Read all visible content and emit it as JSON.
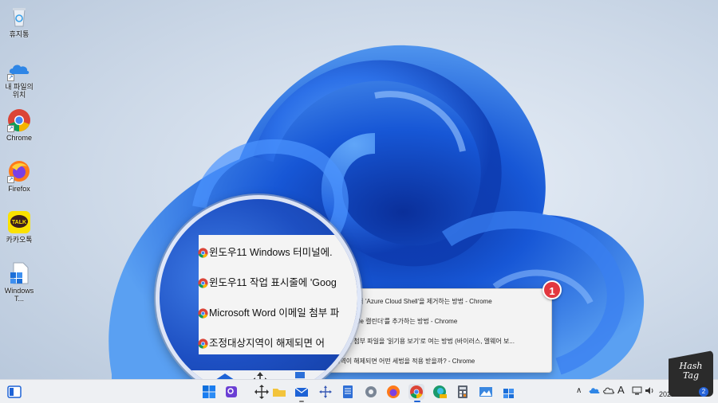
{
  "desktop_icons": [
    {
      "label": "휴지통",
      "icon": "recycle-bin-icon"
    },
    {
      "label": "내 파일의 위치",
      "icon": "onedrive-icon"
    },
    {
      "label": "Chrome",
      "icon": "chrome-icon"
    },
    {
      "label": "Firefox",
      "icon": "firefox-icon"
    },
    {
      "label": "카카오톡",
      "icon": "kakaotalk-icon"
    },
    {
      "label": "WindowsT...",
      "icon": "windows-terminal-file-icon"
    }
  ],
  "kakao_logo_text": "TALK",
  "jump_list": {
    "items": [
      "터미널에서 'Azure Cloud Shell'을 제거하는 방법 - Chrome",
      "에 'Google 캘린더'를 추가하는 방법 - Chrome",
      "이메일 첨부 파일을 '읽기용 보기'로 여는 방법 (바이러스, 멜웨어 보...",
      "지역이 해제되면 어떤 세법을 적용 받을까? - Chrome"
    ]
  },
  "magnifier": {
    "items": [
      "윈도우11 Windows 터미널에.",
      "윈도우11 작업 표시줄에 'Goog",
      "Microsoft Word 이메일 첨부 파",
      "조정대상지역이 해제되면 어"
    ]
  },
  "badge": {
    "number": "1"
  },
  "taskbar": {
    "apps": [
      "widgets-icon",
      "start-icon",
      "search-icon",
      "task-view-icon",
      "file-explorer-icon",
      "mail-icon",
      "move-icon",
      "notepad-icon",
      "settings-icon",
      "firefox-icon",
      "chrome-icon",
      "edge-canary-icon",
      "calculator-icon",
      "photos-icon",
      "terminal-icon"
    ],
    "tray": {
      "ime": "A",
      "date": "2022-09-02"
    }
  },
  "watermark": {
    "line1": "Hash",
    "line2": "Tag"
  },
  "notification_count": "2",
  "colors": {
    "accent_blue": "#1d4fc2",
    "badge_red": "#e2373f",
    "taskbar_bg": "#eef0f3"
  }
}
